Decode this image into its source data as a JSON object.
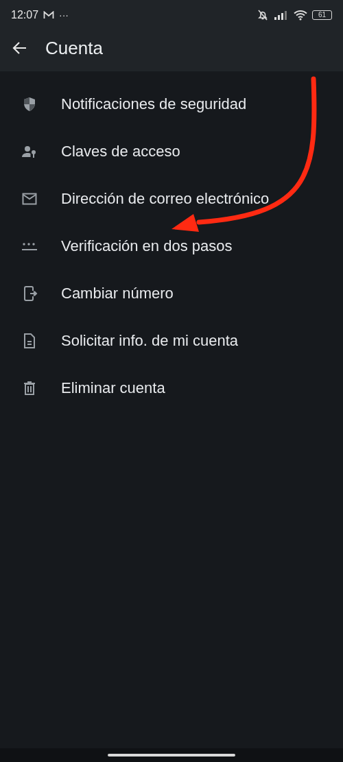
{
  "status_bar": {
    "time": "12:07",
    "more": "···",
    "battery": "61"
  },
  "app_bar": {
    "title": "Cuenta"
  },
  "items": [
    {
      "kind": "shield",
      "label": "Notificaciones de seguridad"
    },
    {
      "kind": "passkey",
      "label": "Claves de acceso"
    },
    {
      "kind": "mail",
      "label": "Dirección de correo electrónico"
    },
    {
      "kind": "password",
      "label": "Verificación en dos pasos"
    },
    {
      "kind": "phone",
      "label": "Cambiar número"
    },
    {
      "kind": "document",
      "label": "Solicitar info. de mi cuenta"
    },
    {
      "kind": "trash",
      "label": "Eliminar cuenta"
    }
  ],
  "annotation": {
    "kind": "arrow",
    "color": "#ff2a12"
  }
}
